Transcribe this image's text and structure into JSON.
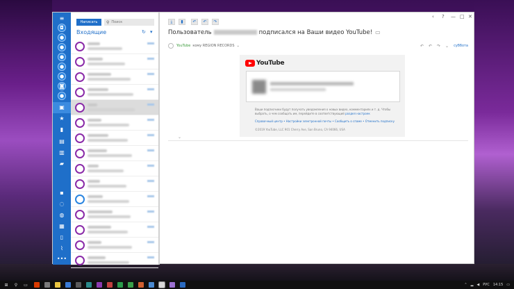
{
  "sidebar": {
    "accounts": [
      "account-1",
      "account-2",
      "account-3",
      "account-4",
      "account-5",
      "account-6"
    ],
    "folders": [
      "inbox-icon",
      "star-icon",
      "document-icon",
      "archive-icon",
      "sent-icon",
      "folder-icon"
    ],
    "bottom": [
      "contacts-icon",
      "bulb-icon",
      "whatsapp-icon",
      "calendar-icon",
      "clipboard-icon",
      "attachment-icon",
      "more-icon"
    ],
    "more_label": "•••"
  },
  "list": {
    "compose_label": "Написать",
    "search_placeholder": "Поиск",
    "folder_title": "Входящие",
    "refresh_glyph": "↻",
    "filter_glyph": "▾",
    "message_count": 15,
    "selected_index": 4
  },
  "toolbar": {
    "buttons": [
      "download-icon",
      "delete-icon",
      "reply-icon",
      "reply-all-icon",
      "forward-icon"
    ]
  },
  "window_controls": {
    "back": "‹",
    "help": "?",
    "minimize": "—",
    "maximize": "□",
    "close": "✕"
  },
  "message": {
    "subject_prefix": "Пользователь",
    "subject_suffix": "подписался на Ваши видео YouTube!",
    "sender_name": "YouTube",
    "recipient_text": "кому REGION RECORDS",
    "recipient_arrow": "⌄",
    "date": "суббота"
  },
  "email_body": {
    "brand": "YouTube",
    "note_text": "Ваши подписчики будут получать уведомления о новых видео, комментариях и т. д. Чтобы выбрать, о чем сообщать им, перейдите в соответствующий",
    "note_link": "раздел настроек",
    "links": "Справочный центр • Настройки электронной почты • Сообщить о спаме • Отменить подписку",
    "copyright": "©2019 YouTube, LLC 901 Cherry Ave, San Bruno, CA 94066, USA"
  },
  "taskbar": {
    "start_glyph": "⊞",
    "search_glyph": "⚲",
    "taskview_glyph": "▭",
    "tray_lang": "РУС",
    "clock": "14:15"
  },
  "colors": {
    "accent": "#1f6fc9",
    "avatar_purple": "#8a2aa8",
    "yt_red": "#ff0000"
  }
}
